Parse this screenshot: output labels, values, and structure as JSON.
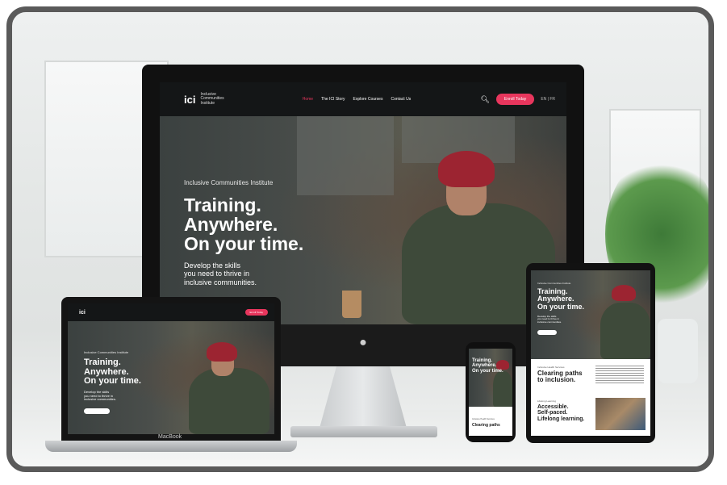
{
  "site": {
    "logo_mark": "ici",
    "logo_text": "Inclusive Communities Institute",
    "nav": [
      "Home",
      "The ICI Story",
      "Explore Courses",
      "Contact Us"
    ],
    "enroll_label": "Enroll Today",
    "lang": "EN | FR",
    "kicker": "Inclusive Communities Institute",
    "headline_1": "Training.",
    "headline_2": "Anywhere.",
    "headline_3": "On your time.",
    "sub_1": "Develop the skills",
    "sub_2": "you need to thrive in",
    "sub_3": "inclusive communities.",
    "section_kicker": "Inclusive Health Services",
    "section_title_1": "Clearing paths",
    "section_title_2": "to inclusion.",
    "lower_kicker": "Lifelong Learning",
    "lower_title_1": "Accessible.",
    "lower_title_2": "Self-paced.",
    "lower_title_3": "Lifelong learning."
  },
  "devices": {
    "laptop_label": "MacBook"
  },
  "colors": {
    "accent": "#e8365d",
    "frame": "#5a5a5a"
  }
}
